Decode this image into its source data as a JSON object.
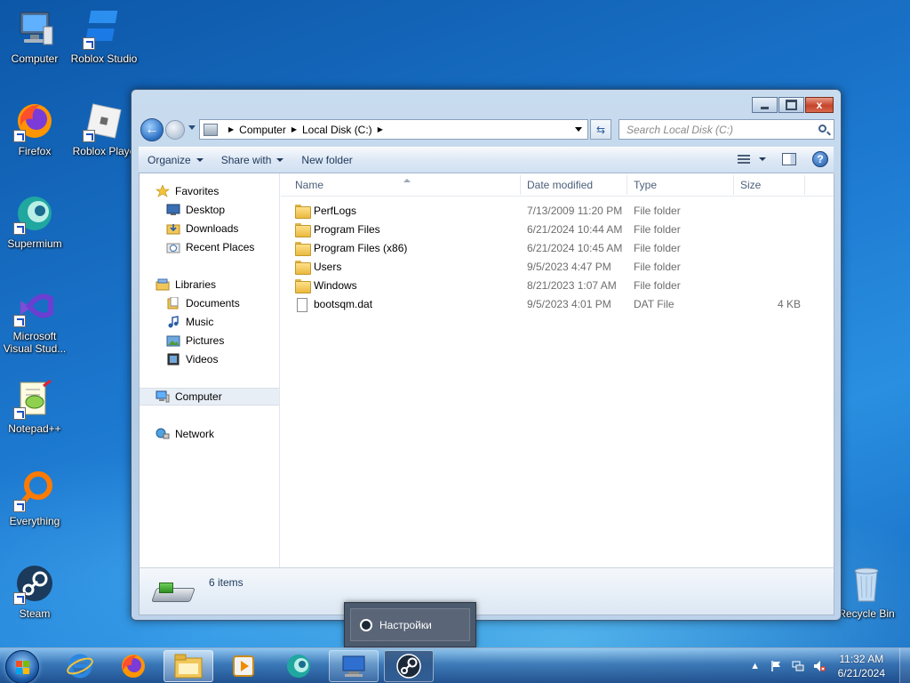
{
  "desktop": {
    "icons": [
      {
        "label": "Computer",
        "icon": "computer-icon"
      },
      {
        "label": "Roblox Studio",
        "icon": "roblox-studio-icon"
      },
      {
        "label": "Firefox",
        "icon": "firefox-icon"
      },
      {
        "label": "Roblox Playe",
        "icon": "roblox-player-icon"
      },
      {
        "label": "Supermium",
        "icon": "supermium-icon"
      },
      {
        "label": "Microsoft Visual Stud...",
        "icon": "visual-studio-icon"
      },
      {
        "label": "Notepad++",
        "icon": "notepadpp-icon"
      },
      {
        "label": "Everything",
        "icon": "everything-icon"
      },
      {
        "label": "Steam",
        "icon": "steam-icon"
      },
      {
        "label": "Recycle Bin",
        "icon": "recycle-bin-icon"
      }
    ]
  },
  "window": {
    "controls": {
      "close_label": "x"
    },
    "address": {
      "crumbs": [
        "Computer",
        "Local Disk (C:)"
      ]
    },
    "search": {
      "placeholder": "Search Local Disk (C:)"
    },
    "toolbar": {
      "organize": "Organize",
      "share_with": "Share with",
      "new_folder": "New folder",
      "help_label": "?"
    },
    "nav_pane": {
      "favorites": {
        "label": "Favorites",
        "items": [
          "Desktop",
          "Downloads",
          "Recent Places"
        ]
      },
      "libraries": {
        "label": "Libraries",
        "items": [
          "Documents",
          "Music",
          "Pictures",
          "Videos"
        ]
      },
      "computer": "Computer",
      "network": "Network"
    },
    "columns": {
      "name": "Name",
      "date_modified": "Date modified",
      "type": "Type",
      "size": "Size"
    },
    "files": [
      {
        "name": "PerfLogs",
        "date": "7/13/2009 11:20 PM",
        "type": "File folder",
        "size": "",
        "kind": "folder"
      },
      {
        "name": "Program Files",
        "date": "6/21/2024 10:44 AM",
        "type": "File folder",
        "size": "",
        "kind": "folder"
      },
      {
        "name": "Program Files (x86)",
        "date": "6/21/2024 10:45 AM",
        "type": "File folder",
        "size": "",
        "kind": "folder"
      },
      {
        "name": "Users",
        "date": "9/5/2023 4:47 PM",
        "type": "File folder",
        "size": "",
        "kind": "folder"
      },
      {
        "name": "Windows",
        "date": "8/21/2023 1:07 AM",
        "type": "File folder",
        "size": "",
        "kind": "folder"
      },
      {
        "name": "bootsqm.dat",
        "date": "9/5/2023 4:01 PM",
        "type": "DAT File",
        "size": "4 KB",
        "kind": "file"
      }
    ],
    "status": {
      "item_count": "6 items"
    }
  },
  "popup": {
    "label": "Настройки"
  },
  "taskbar": {
    "apps": [
      "internet-explorer-icon",
      "firefox-icon",
      "file-explorer-icon",
      "media-player-icon",
      "supermium-icon",
      "remote-desktop-icon",
      "steam-icon"
    ],
    "clock": {
      "time": "11:32 AM",
      "date": "6/21/2024"
    },
    "tray": {
      "expand_label": "▲"
    }
  },
  "colors": {
    "accent": "#1a6fc4",
    "selection": "#e8eef6",
    "close": "#c6442a"
  }
}
